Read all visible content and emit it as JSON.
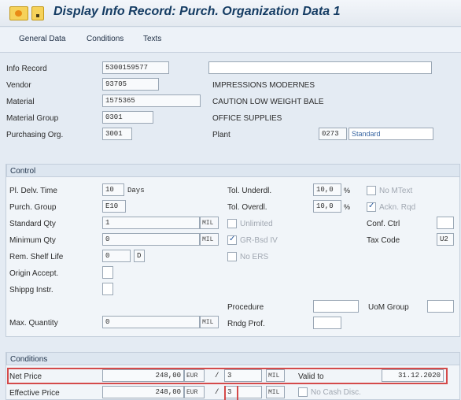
{
  "window": {
    "title": "Display Info Record: Purch. Organization Data 1"
  },
  "toolbar": {
    "general_data": "General Data",
    "conditions": "Conditions",
    "texts": "Texts"
  },
  "header": {
    "info_record_label": "Info Record",
    "info_record_value": "5300159577",
    "vendor_label": "Vendor",
    "vendor_value": "93705",
    "vendor_name": "IMPRESSIONS MODERNES",
    "material_label": "Material",
    "material_value": "1575365",
    "material_name": "CAUTION LOW WEIGHT BALE",
    "material_group_label": "Material Group",
    "material_group_value": "0301",
    "material_group_name": "OFFICE SUPPLIES",
    "purch_org_label": "Purchasing Org.",
    "purch_org_value": "3001",
    "plant_label": "Plant",
    "plant_value": "0273",
    "plant_name": "Standard"
  },
  "control": {
    "title": "Control",
    "pl_delv_time_label": "Pl. Delv. Time",
    "pl_delv_time_value": "10",
    "pl_delv_time_unit": "Days",
    "purch_group_label": "Purch. Group",
    "purch_group_value": "E10",
    "standard_qty_label": "Standard Qty",
    "standard_qty_value": "1",
    "standard_qty_unit": "MIL",
    "minimum_qty_label": "Minimum Qty",
    "minimum_qty_value": "0",
    "minimum_qty_unit": "MIL",
    "rem_shelf_life_label": "Rem. Shelf Life",
    "rem_shelf_life_value": "0",
    "rem_shelf_life_unit": "D",
    "origin_accept_label": "Origin Accept.",
    "shipping_instr_label": "Shippg Instr.",
    "max_quantity_label": "Max. Quantity",
    "max_quantity_value": "0",
    "max_quantity_unit": "MIL",
    "tol_underdl_label": "Tol. Underdl.",
    "tol_underdl_value": "10,0",
    "tol_underdl_unit": "%",
    "tol_overdl_label": "Tol. Overdl.",
    "tol_overdl_value": "10,0",
    "tol_overdl_unit": "%",
    "unlimited_label": "Unlimited",
    "grbsd_iv_label": "GR-Bsd IV",
    "no_ers_label": "No ERS",
    "no_mtext_label": "No MText",
    "ackn_rqd_label": "Ackn. Rqd",
    "conf_ctrl_label": "Conf. Ctrl",
    "tax_code_label": "Tax Code",
    "tax_code_value": "U2",
    "procedure_label": "Procedure",
    "rndg_prof_label": "Rndg Prof.",
    "uom_group_label": "UoM Group",
    "checks": {
      "ackn_rqd": true,
      "grbsd_iv": true
    }
  },
  "conditions": {
    "title": "Conditions",
    "net_price_label": "Net Price",
    "net_price_value": "248,00",
    "net_price_currency": "EUR",
    "net_price_slash": "/",
    "net_price_per": "3",
    "net_price_uom": "MIL",
    "valid_to_label": "Valid to",
    "valid_to_value": "31.12.2020",
    "effective_price_label": "Effective Price",
    "effective_price_value": "248,00",
    "effective_price_currency": "EUR",
    "effective_price_slash": "/",
    "effective_price_per": "3",
    "effective_price_uom": "MIL",
    "no_cash_disc_label": "No Cash Disc."
  },
  "colors": {
    "accent_blue": "#153c63",
    "highlight_red": "#d44a4a"
  },
  "icons": {
    "title_icon": "info-record-icon",
    "status_icon": "status-icon"
  }
}
